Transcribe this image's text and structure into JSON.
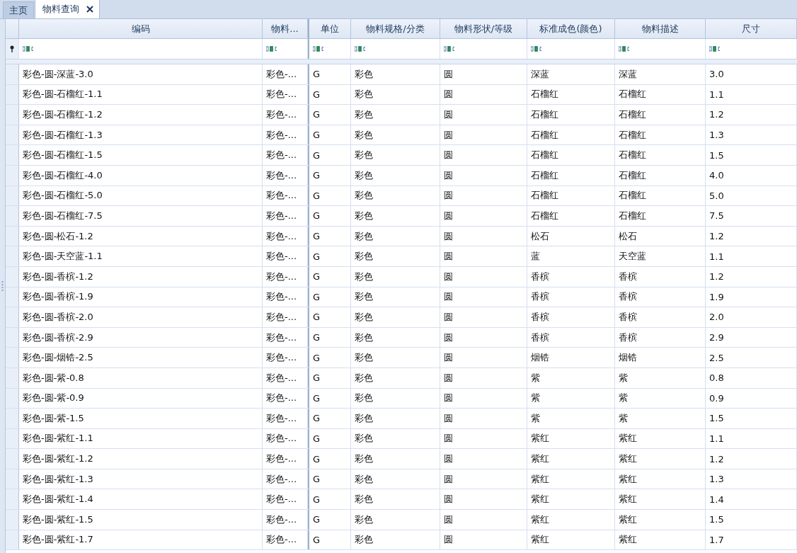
{
  "tabs": [
    {
      "label": "主页",
      "selected": false,
      "closable": false
    },
    {
      "label": "物料查询",
      "selected": true,
      "closable": true
    }
  ],
  "table": {
    "columns": [
      "编码",
      "物料...",
      "单位",
      "物料规格/分类",
      "物料形状/等级",
      "标准成色(颜色)",
      "物料描述",
      "尺寸"
    ],
    "rows": [
      {
        "cells": [
          "彩色-圆-深蓝-3.0",
          "彩色-...",
          "G",
          "彩色",
          "圆",
          "深蓝",
          "深蓝",
          "3.0"
        ]
      },
      {
        "cells": [
          "彩色-圆-石榴红-1.1",
          "彩色-...",
          "G",
          "彩色",
          "圆",
          "石榴红",
          "石榴红",
          "1.1"
        ]
      },
      {
        "cells": [
          "彩色-圆-石榴红-1.2",
          "彩色-...",
          "G",
          "彩色",
          "圆",
          "石榴红",
          "石榴红",
          "1.2"
        ]
      },
      {
        "cells": [
          "彩色-圆-石榴红-1.3",
          "彩色-...",
          "G",
          "彩色",
          "圆",
          "石榴红",
          "石榴红",
          "1.3"
        ]
      },
      {
        "cells": [
          "彩色-圆-石榴红-1.5",
          "彩色-...",
          "G",
          "彩色",
          "圆",
          "石榴红",
          "石榴红",
          "1.5"
        ]
      },
      {
        "cells": [
          "彩色-圆-石榴红-4.0",
          "彩色-...",
          "G",
          "彩色",
          "圆",
          "石榴红",
          "石榴红",
          "4.0"
        ]
      },
      {
        "cells": [
          "彩色-圆-石榴红-5.0",
          "彩色-...",
          "G",
          "彩色",
          "圆",
          "石榴红",
          "石榴红",
          "5.0"
        ]
      },
      {
        "cells": [
          "彩色-圆-石榴红-7.5",
          "彩色-...",
          "G",
          "彩色",
          "圆",
          "石榴红",
          "石榴红",
          "7.5"
        ]
      },
      {
        "cells": [
          "彩色-圆-松石-1.2",
          "彩色-...",
          "G",
          "彩色",
          "圆",
          "松石",
          "松石",
          "1.2"
        ]
      },
      {
        "cells": [
          "彩色-圆-天空蓝-1.1",
          "彩色-...",
          "G",
          "彩色",
          "圆",
          "蓝",
          "天空蓝",
          "1.1"
        ]
      },
      {
        "cells": [
          "彩色-圆-香槟-1.2",
          "彩色-...",
          "G",
          "彩色",
          "圆",
          "香槟",
          "香槟",
          "1.2"
        ]
      },
      {
        "cells": [
          "彩色-圆-香槟-1.9",
          "彩色-...",
          "G",
          "彩色",
          "圆",
          "香槟",
          "香槟",
          "1.9"
        ]
      },
      {
        "cells": [
          "彩色-圆-香槟-2.0",
          "彩色-...",
          "G",
          "彩色",
          "圆",
          "香槟",
          "香槟",
          "2.0"
        ]
      },
      {
        "cells": [
          "彩色-圆-香槟-2.9",
          "彩色-...",
          "G",
          "彩色",
          "圆",
          "香槟",
          "香槟",
          "2.9"
        ]
      },
      {
        "cells": [
          "彩色-圆-烟锆-2.5",
          "彩色-...",
          "G",
          "彩色",
          "圆",
          "烟锆",
          "烟锆",
          "2.5"
        ]
      },
      {
        "cells": [
          "彩色-圆-紫-0.8",
          "彩色-...",
          "G",
          "彩色",
          "圆",
          "紫",
          "紫",
          "0.8"
        ]
      },
      {
        "cells": [
          "彩色-圆-紫-0.9",
          "彩色-...",
          "G",
          "彩色",
          "圆",
          "紫",
          "紫",
          "0.9"
        ]
      },
      {
        "cells": [
          "彩色-圆-紫-1.5",
          "彩色-...",
          "G",
          "彩色",
          "圆",
          "紫",
          "紫",
          "1.5"
        ]
      },
      {
        "cells": [
          "彩色-圆-紫红-1.1",
          "彩色-...",
          "G",
          "彩色",
          "圆",
          "紫红",
          "紫红",
          "1.1"
        ]
      },
      {
        "cells": [
          "彩色-圆-紫红-1.2",
          "彩色-...",
          "G",
          "彩色",
          "圆",
          "紫红",
          "紫红",
          "1.2"
        ]
      },
      {
        "cells": [
          "彩色-圆-紫红-1.3",
          "彩色-...",
          "G",
          "彩色",
          "圆",
          "紫红",
          "紫红",
          "1.3"
        ]
      },
      {
        "cells": [
          "彩色-圆-紫红-1.4",
          "彩色-...",
          "G",
          "彩色",
          "圆",
          "紫红",
          "紫红",
          "1.4"
        ]
      },
      {
        "cells": [
          "彩色-圆-紫红-1.5",
          "彩色-...",
          "G",
          "彩色",
          "圆",
          "紫红",
          "紫红",
          "1.5"
        ]
      },
      {
        "cells": [
          "彩色-圆-紫红-1.7",
          "彩色-...",
          "G",
          "彩色",
          "圆",
          "紫红",
          "紫红",
          "1.7"
        ]
      }
    ]
  }
}
